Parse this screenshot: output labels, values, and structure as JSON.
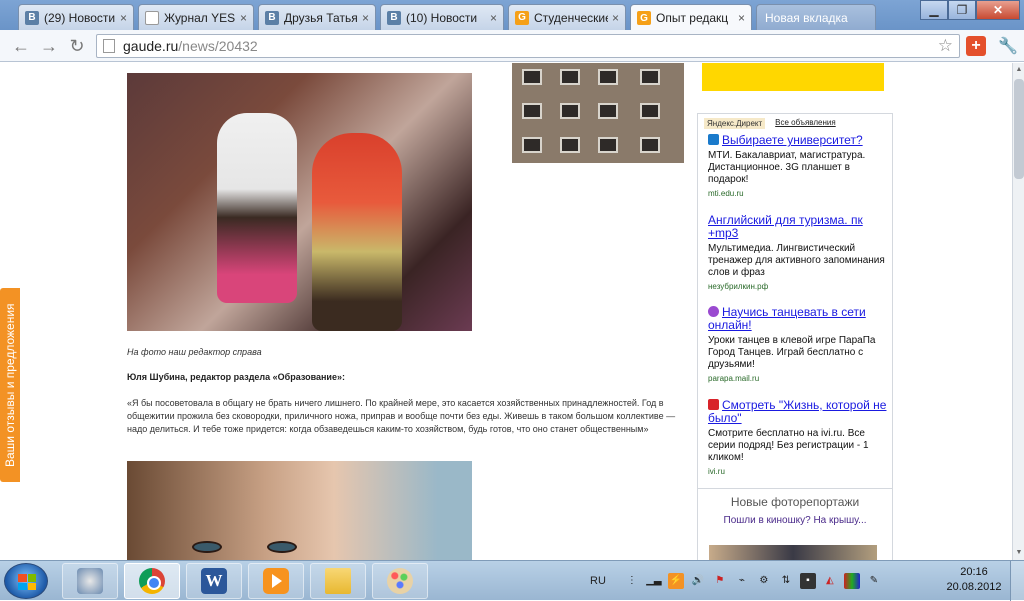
{
  "browser": {
    "tabs": [
      {
        "title": "(29) Новости",
        "icon": "vk-icon"
      },
      {
        "title": "Журнал YES!",
        "icon": "page-icon"
      },
      {
        "title": "Друзья Татья",
        "icon": "vk-icon"
      },
      {
        "title": "(10) Новости",
        "icon": "vk-icon"
      },
      {
        "title": "Студенческие",
        "icon": "gaude-icon"
      },
      {
        "title": "Опыт редакц",
        "icon": "gaude-icon",
        "active": true
      }
    ],
    "new_tab_label": "Новая вкладка",
    "url_host": "gaude.ru",
    "url_path": "/news/20432",
    "tab_close": "×"
  },
  "article": {
    "caption": "На фото наш редактор справа",
    "author": "Юля Шубина, редактор раздела «Образование»:",
    "quote": "«Я бы посоветовала в общагу не брать ничего лишнего. По крайней мере, это касается хозяйственных принадлежностей. Год в общежитии прожила без сковородки, приличного ножа, приправ и вообще почти без еды. Живешь в таком большом коллективе — надо делиться. И тебе тоже придется: когда обзаведешься каким-то хозяйством, будь готов, что оно станет общественным»"
  },
  "sidebar": {
    "direct_label": "Яндекс.Директ",
    "all_ads_label": "Все объявления",
    "ads": [
      {
        "title": "Выбираете университет?",
        "body": "МТИ. Бакалавриат, магистратура. Дистанционное. 3G планшет в подарок!",
        "domain": "mti.edu.ru",
        "icon_color": "#1a7acb"
      },
      {
        "title": "Английский для туризма. пк +mp3",
        "body": "Мультимедиа. Лингвистический тренажер для активного запоминания слов и фраз",
        "domain": "незубрилкин.рф",
        "icon_color": ""
      },
      {
        "title": "Научись танцевать в сети онлайн!",
        "body": "Уроки танцев в клевой игре ПараПа Город Танцев. Играй бесплатно с друзьями!",
        "domain": "parapa.mail.ru",
        "icon_color": "#9a4ad0"
      },
      {
        "title": "Смотреть \"Жизнь, которой не было\"",
        "body": "Смотрите бесплатно на ivi.ru. Все серии подряд! Без регистрации - 1 кликом!",
        "domain": "ivi.ru",
        "icon_color": "#d8232a"
      }
    ],
    "photoreports_title": "Новые фоторепортажи",
    "photoreports_link": "Пошли в киношку? На крышу..."
  },
  "feedback_label": "Ваши отзывы и предложения",
  "taskbar": {
    "language": "RU",
    "time": "20:16",
    "date": "20.08.2012"
  }
}
